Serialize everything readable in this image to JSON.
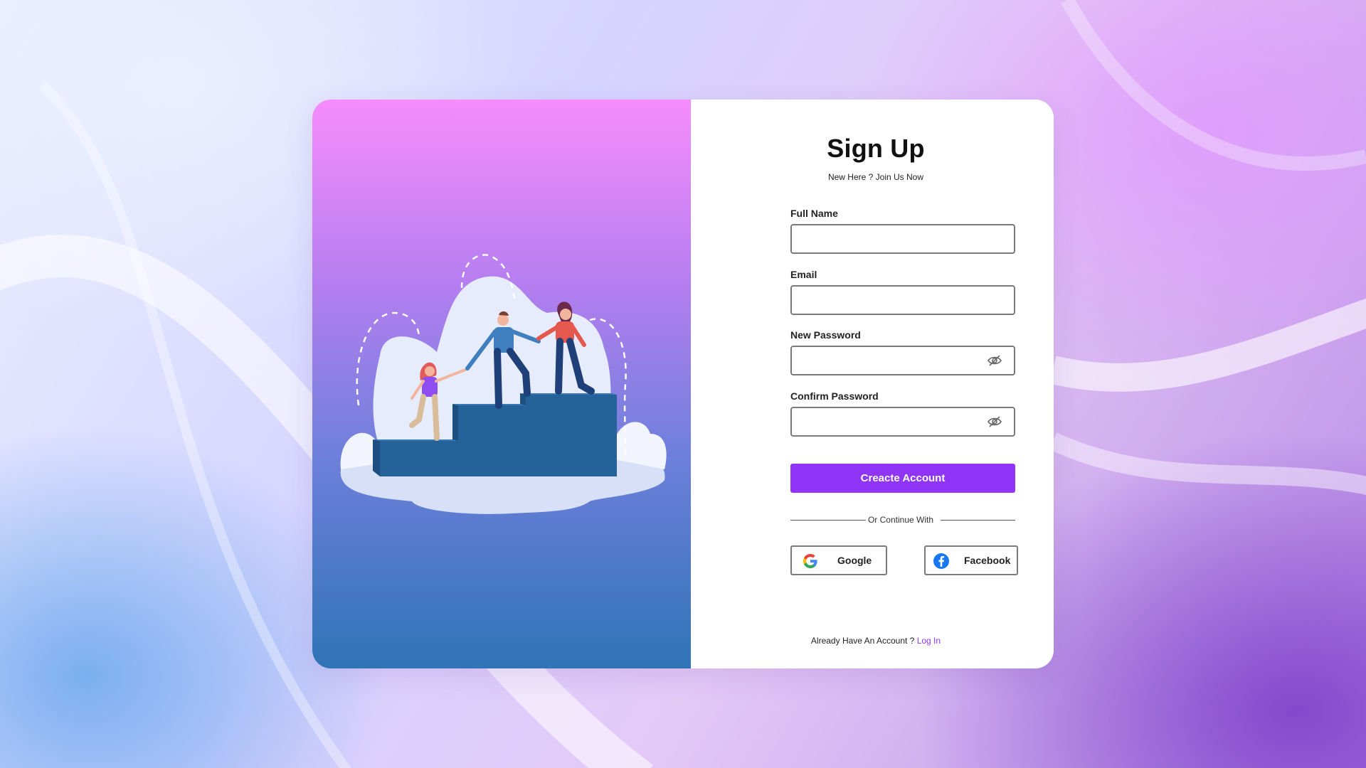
{
  "signup": {
    "title": "Sign Up",
    "subtitle": "New Here ? Join Us Now"
  },
  "fields": {
    "full_name": {
      "label": "Full Name",
      "value": "",
      "placeholder": ""
    },
    "email": {
      "label": "Email",
      "value": "",
      "placeholder": ""
    },
    "new_password": {
      "label": "New Password",
      "value": "",
      "placeholder": ""
    },
    "confirm_password": {
      "label": "Confirm Password",
      "value": "",
      "placeholder": ""
    }
  },
  "actions": {
    "create_account_label": "Creacte Account",
    "divider_text": "Or Continue With",
    "google_label": "Google",
    "facebook_label": "Facebook"
  },
  "footer": {
    "prompt": "Already Have An Account ?",
    "login_link": "Log In"
  },
  "icons": {
    "password_toggle": "eye-slash-icon",
    "google": "google-icon",
    "facebook": "facebook-icon"
  },
  "colors": {
    "accent": "#9035f7",
    "panel_gradient_top": "#f68cfd",
    "panel_gradient_bottom": "#2f74b6",
    "step_blue": "#26649b",
    "facebook_blue": "#1877f2"
  }
}
